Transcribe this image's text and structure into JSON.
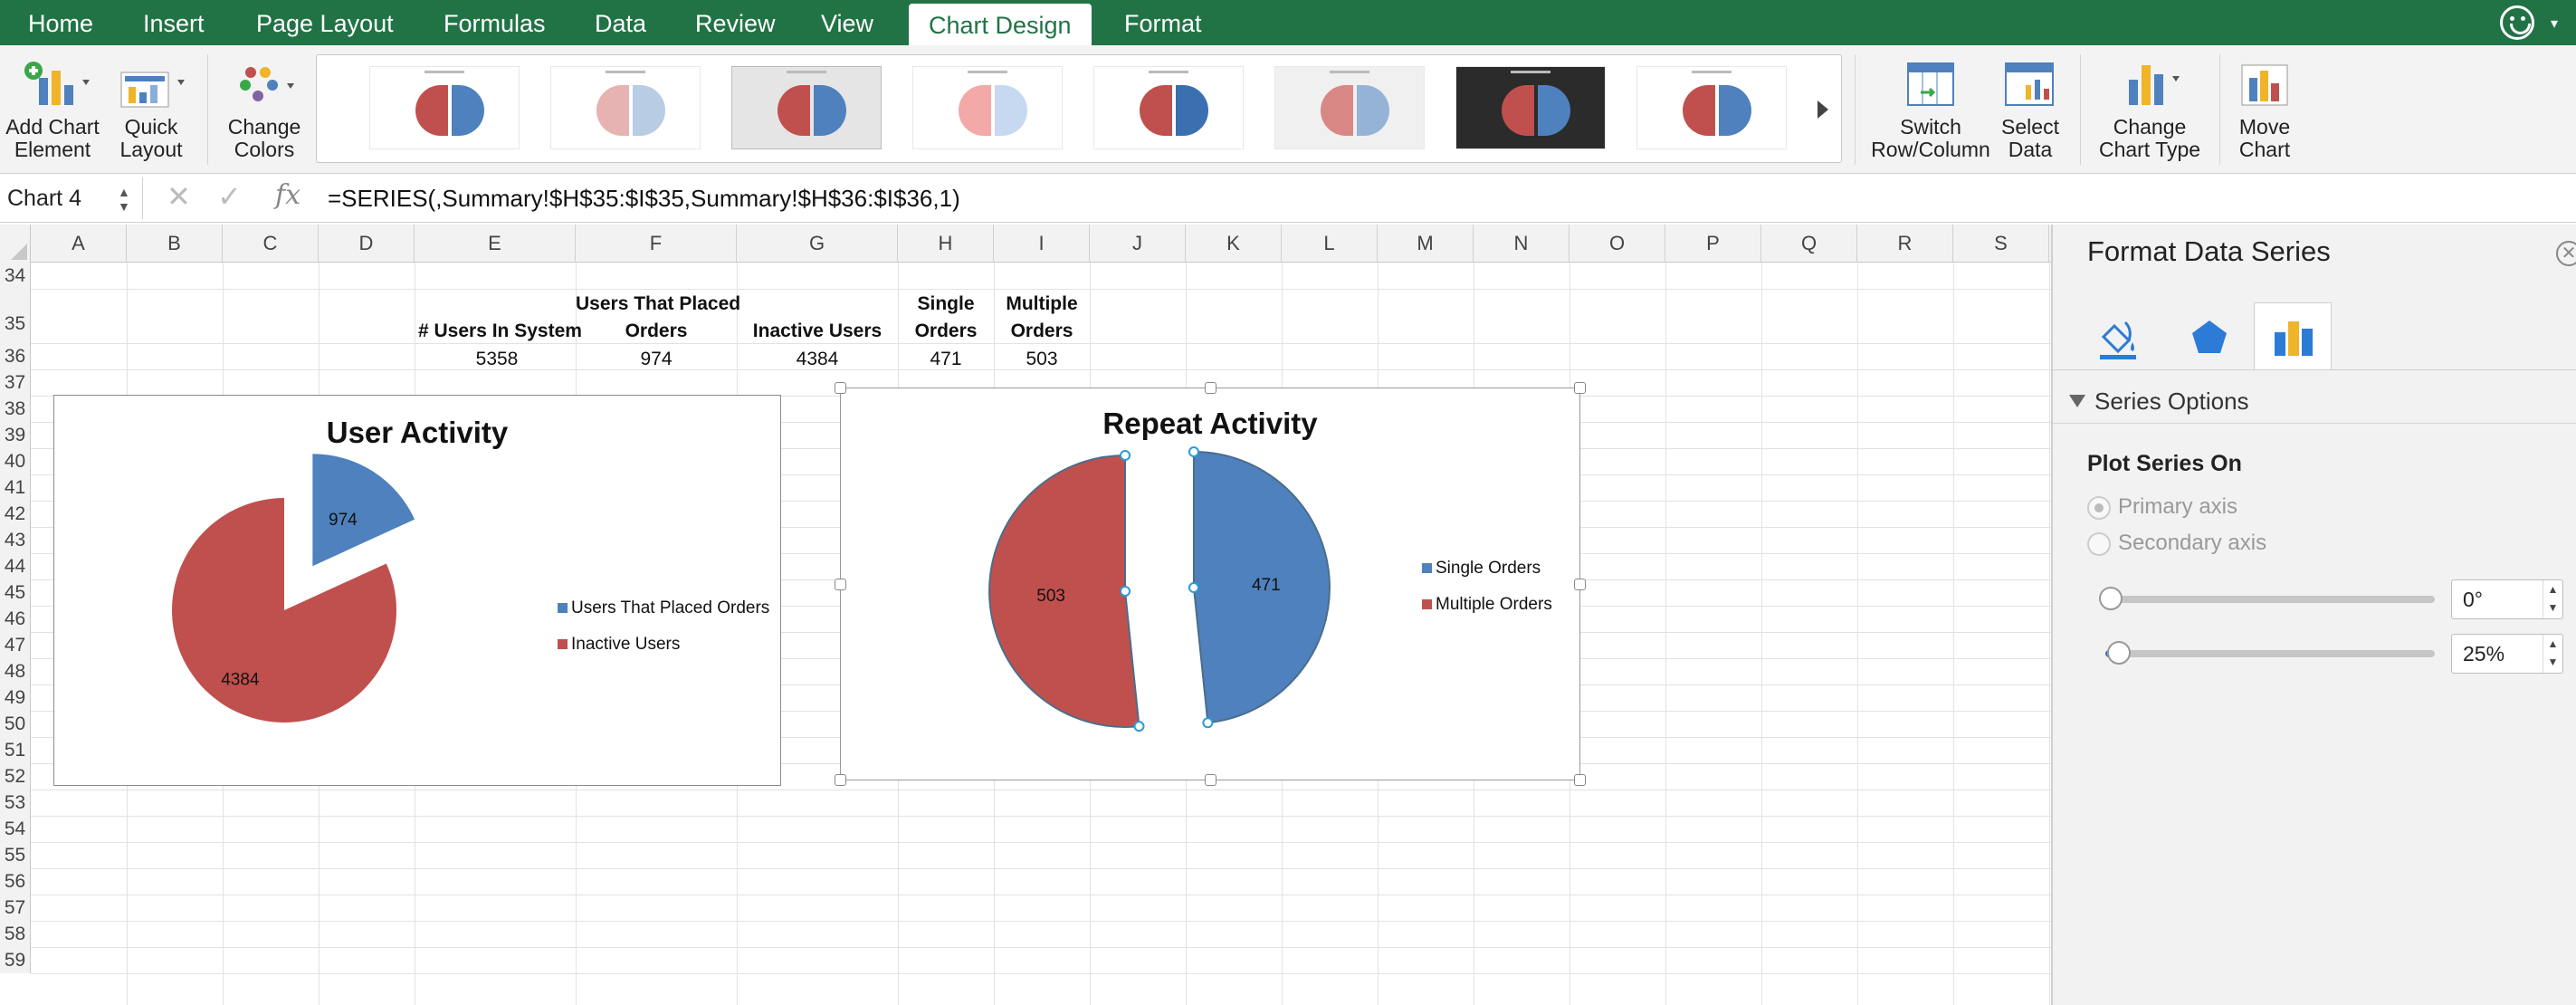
{
  "menu_tabs": [
    {
      "label": "Home"
    },
    {
      "label": "Insert"
    },
    {
      "label": "Page Layout"
    },
    {
      "label": "Formulas"
    },
    {
      "label": "Data"
    },
    {
      "label": "Review"
    },
    {
      "label": "View"
    },
    {
      "label": "Chart Design",
      "active": true
    },
    {
      "label": "Format"
    }
  ],
  "ribbon": {
    "add_chart_element": {
      "line1": "Add Chart",
      "line2": "Element"
    },
    "quick_layout": {
      "line1": "Quick",
      "line2": "Layout"
    },
    "change_colors": {
      "line1": "Change",
      "line2": "Colors"
    },
    "switch_row_column": {
      "line1": "Switch",
      "line2": "Row/Column"
    },
    "select_data": {
      "line1": "Select",
      "line2": "Data"
    },
    "change_chart_type": {
      "line1": "Change",
      "line2": "Chart Type"
    },
    "move_chart": {
      "line1": "Move",
      "line2": "Chart"
    },
    "chart_styles_count": 8
  },
  "formula_bar": {
    "name_box": "Chart 4",
    "fx_label": "fx",
    "formula": "=SERIES(,Summary!$H$35:$I$35,Summary!$H$36:$I$36,1)"
  },
  "columns": [
    "A",
    "B",
    "C",
    "D",
    "E",
    "F",
    "G",
    "H",
    "I",
    "J",
    "K",
    "L",
    "M",
    "N",
    "O",
    "P",
    "Q",
    "R",
    "S"
  ],
  "rows": [
    "34",
    "35",
    "36",
    "37",
    "38",
    "39",
    "40",
    "41",
    "42",
    "43",
    "44",
    "45",
    "46",
    "47",
    "48",
    "49",
    "50",
    "51",
    "52",
    "53",
    "54",
    "55",
    "56",
    "57",
    "58",
    "59"
  ],
  "cells": {
    "e35": "# Users In System",
    "f35_line1": "Users That Placed",
    "f35_line2": "Orders",
    "g35": "Inactive Users",
    "h35_line1": "Single",
    "h35_line2": "Orders",
    "i35_line1": "Multiple",
    "i35_line2": "Orders",
    "e36": "5358",
    "f36": "974",
    "g36": "4384",
    "h36": "471",
    "i36": "503"
  },
  "chart_data": [
    {
      "type": "pie",
      "title": "User Activity",
      "categories": [
        "Users That Placed Orders",
        "Inactive Users"
      ],
      "values": [
        974,
        4384
      ],
      "data_labels": [
        "974",
        "4384"
      ],
      "colors": [
        "#4e81bd",
        "#c0504d"
      ],
      "exploded": true,
      "legend": "right"
    },
    {
      "type": "pie",
      "title": "Repeat Activity",
      "categories": [
        "Single Orders",
        "Multiple Orders"
      ],
      "values": [
        471,
        503
      ],
      "data_labels": [
        "471",
        "503"
      ],
      "colors": [
        "#4e81bd",
        "#c0504d"
      ],
      "exploded": true,
      "selected": true,
      "legend": "right"
    }
  ],
  "panel": {
    "title": "Format Data Series",
    "section": "Series Options",
    "plot_series_on": "Plot Series On",
    "primary_axis": "Primary axis",
    "secondary_axis": "Secondary axis",
    "primary_selected": true,
    "angle_value": "0°",
    "angle_fraction": 0,
    "explosion_value": "25%",
    "explosion_fraction": 0.04,
    "tabs": [
      "fill-line-icon",
      "effects-icon",
      "series-options-icon"
    ]
  },
  "colors": {
    "excel_green": "#217346",
    "blue": "#4e81bd",
    "red": "#c0504d"
  }
}
